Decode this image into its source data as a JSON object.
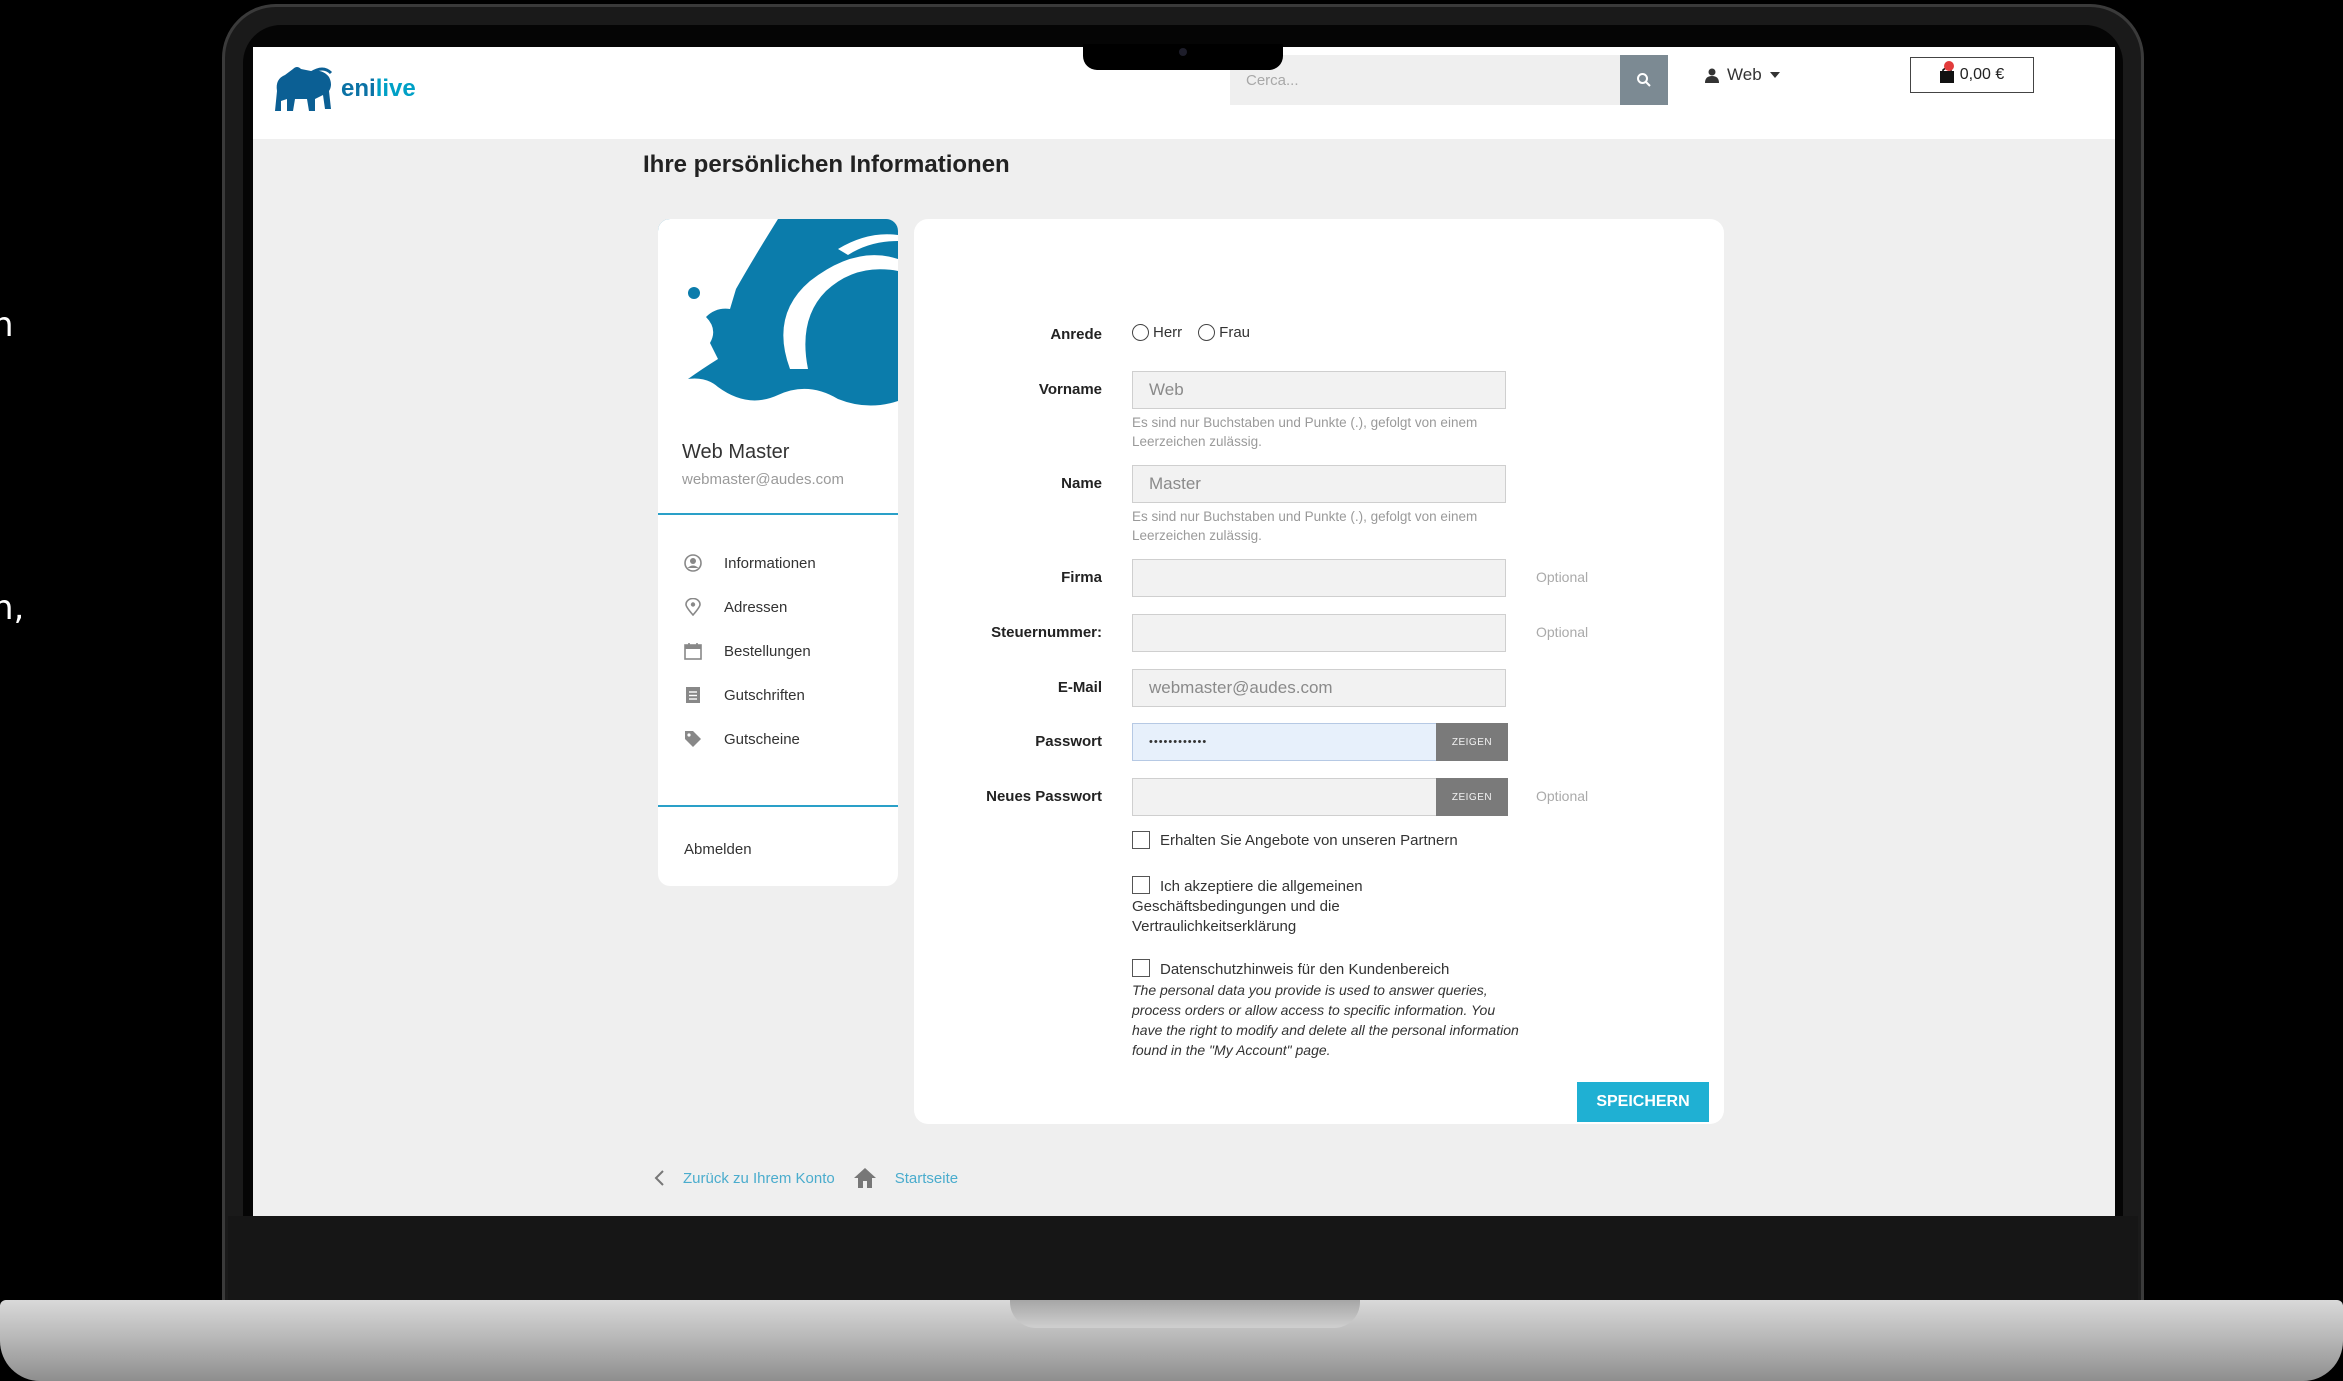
{
  "background": {
    "cropped_text": [
      "n",
      "n,"
    ]
  },
  "header": {
    "logo_text_1": "eni",
    "logo_text_2": "live",
    "search_placeholder": "Cerca...",
    "user_label": "Web",
    "cart_total": "0,00 €"
  },
  "page": {
    "title": "Ihre persönlichen Informationen"
  },
  "profile": {
    "name": "Web Master",
    "email": "webmaster@audes.com",
    "menu": [
      {
        "label": "Informationen",
        "icon": "user-circle-icon"
      },
      {
        "label": "Adressen",
        "icon": "location-pin-icon"
      },
      {
        "label": "Bestellungen",
        "icon": "calendar-icon"
      },
      {
        "label": "Gutschriften",
        "icon": "document-icon"
      },
      {
        "label": "Gutscheine",
        "icon": "tag-icon"
      }
    ],
    "logout": "Abmelden"
  },
  "form": {
    "salutation_label": "Anrede",
    "salutation_options": [
      "Herr",
      "Frau"
    ],
    "firstname_label": "Vorname",
    "firstname_value": "Web",
    "name_help": "Es sind nur Buchstaben und Punkte (.), gefolgt von einem Leerzeichen zulässig.",
    "lastname_label": "Name",
    "lastname_value": "Master",
    "company_label": "Firma",
    "tax_label": "Steuernummer:",
    "email_label": "E-Mail",
    "email_value": "webmaster@audes.com",
    "password_label": "Passwort",
    "password_value": "••••••••••••",
    "new_password_label": "Neues Passwort",
    "optional": "Optional",
    "show": "ZEIGEN",
    "partner_offers": "Erhalten Sie Angebote von unseren Partnern",
    "terms": "Ich akzeptiere die allgemeinen Geschäftsbedingungen und die Vertraulichkeitserklärung",
    "privacy_title": "Datenschutzhinweis für den Kundenbereich",
    "privacy_text": "The personal data you provide is used to answer queries, process orders or allow access to specific information. You have the right to modify and delete all the personal information found in the \"My Account\" page.",
    "save": "SPEICHERN"
  },
  "footer": {
    "back": "Zurück zu Ihrem Konto",
    "home": "Startseite"
  },
  "colors": {
    "brand": "#0b7cab",
    "accent": "#1fb0d3",
    "link": "#4aaccd"
  }
}
